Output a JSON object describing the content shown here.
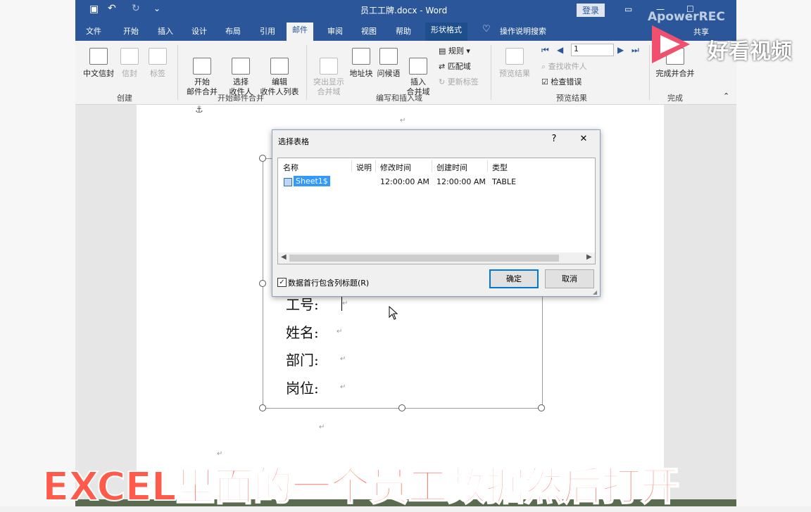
{
  "window": {
    "title": "员工工牌.docx  -  Word",
    "login_button": "登录",
    "share_button": "共享"
  },
  "ribbon_tabs": [
    "文件",
    "开始",
    "插入",
    "设计",
    "布局",
    "引用",
    "邮件",
    "审阅",
    "视图",
    "帮助",
    "形状格式"
  ],
  "tell_me": "操作说明搜索",
  "ribbon": {
    "create": {
      "label": "创建",
      "envelopes": "中文信封",
      "envelope": "信封",
      "labels": "标签"
    },
    "start": {
      "label": "开始邮件合并",
      "start_merge": "开始\n邮件合并",
      "select_recipients": "选择\n收件人",
      "edit_list": "编辑\n收件人列表"
    },
    "write": {
      "label": "编写和插入域",
      "highlight": "突出显示\n合并域",
      "address_block": "地址块",
      "greeting": "问候语",
      "insert_field": "插入\n合并域",
      "rules": "规则",
      "match_fields": "匹配域",
      "update_labels": "更新标签"
    },
    "preview": {
      "label": "预览结果",
      "preview_results": "预览结果",
      "record": "1",
      "find_recipient": "查找收件人",
      "check_errors": "检查错误"
    },
    "finish": {
      "label": "完成",
      "finish_merge": "完成并合并"
    }
  },
  "document": {
    "fields": [
      "工号:",
      "姓名:",
      "部门:",
      "岗位:"
    ]
  },
  "dialog": {
    "title": "选择表格",
    "help": "?",
    "close": "✕",
    "columns": [
      "名称",
      "说明",
      "修改时间",
      "创建时间",
      "类型"
    ],
    "rows": [
      {
        "name": "Sheet1$",
        "description": "",
        "modified": "12:00:00 AM",
        "created": "12:00:00 AM",
        "type": "TABLE"
      }
    ],
    "checkbox_label": "数据首行包含列标题(R)",
    "checkbox_checked": true,
    "ok": "确定",
    "cancel": "取消"
  },
  "overlay": {
    "caption": "EXCEL里面的一个员工数据然后打开",
    "watermark_text": "好看视频",
    "recorder": "ApowerREC"
  },
  "colors": {
    "title_bar": "#2b579a",
    "caption": "#ff5a4a",
    "selection": "#3399ff"
  }
}
